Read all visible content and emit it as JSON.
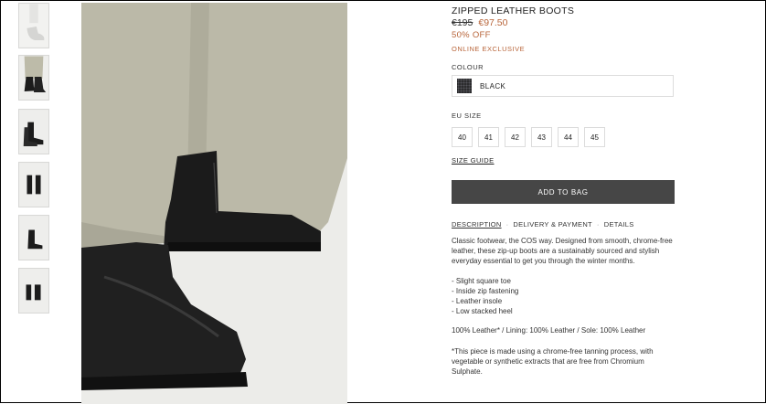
{
  "product": {
    "title": "ZIPPED LEATHER BOOTS",
    "price_original": "€195",
    "price_sale": "€97.50",
    "discount": "50% OFF",
    "badge": "ONLINE EXCLUSIVE"
  },
  "colour": {
    "label": "COLOUR",
    "selected": "BLACK",
    "swatch_color": "#2c2c2e"
  },
  "size": {
    "label": "EU SIZE",
    "options": [
      "40",
      "41",
      "42",
      "43",
      "44",
      "45"
    ],
    "guide_label": "SIZE GUIDE"
  },
  "cart": {
    "add_label": "ADD TO BAG"
  },
  "tabs": [
    {
      "label": "DESCRIPTION",
      "active": true
    },
    {
      "label": "DELIVERY & PAYMENT",
      "active": false
    },
    {
      "label": "DETAILS",
      "active": false
    }
  ],
  "tab_separator": "·",
  "description": {
    "text": "Classic footwear, the COS way. Designed from smooth, chrome-free leather, these zip-up boots are a sustainably sourced and stylish everyday essential to get you through the winter months.",
    "bullets": [
      "- Slight square toe",
      "- Inside zip fastening",
      "- Leather insole",
      "- Low stacked heel"
    ],
    "composition": "100% Leather* / Lining: 100% Leather / Sole: 100% Leather",
    "note": "*This piece is made using a chrome-free tanning process, with vegetable or synthetic extracts that are free from Chromium Sulphate."
  },
  "colors": {
    "sale": "#b8653a",
    "button": "#464646"
  }
}
